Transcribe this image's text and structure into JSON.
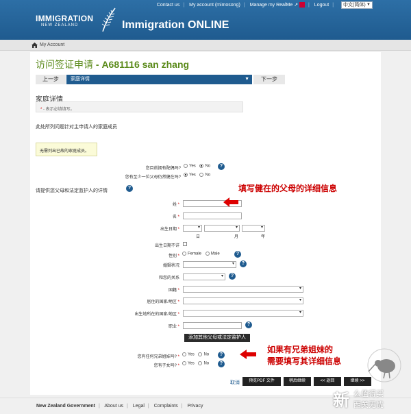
{
  "header": {
    "brand_main": "IMMIGRATION",
    "brand_sub": "NEW ZEALAND",
    "app_title": "Immigration ONLINE",
    "nav": [
      "Contact us",
      "My account (mimosong)",
      "Manage my RealMe",
      "Logout"
    ],
    "language": "中文(简体)"
  },
  "breadcrumb": {
    "label": "My Account"
  },
  "page": {
    "title": "访问签证申请",
    "app_ref": "- A681116 san zhang",
    "prev_label": "上一步",
    "current_step": "家庭详情",
    "next_label": "下一步",
    "section_title": "家庭详情",
    "required_note": "- 表示必填填写。",
    "required_star": "*",
    "intro": "此处所列问题针对主申请人的家庭成员",
    "deceased_note": "无需列出已故的家庭成员。"
  },
  "questions": {
    "partner_q": "您目前拥有配偶吗?",
    "partner_yes": "Yes",
    "partner_no": "No",
    "parent_alive_q": "您有至少一位父母仍然健在吗?",
    "parent_alive_yes": "Yes",
    "parent_alive_no": "No",
    "parent_details_prompt": "请提供您父母和法定监护人的详情"
  },
  "form": {
    "surname": "姓",
    "given_name": "名",
    "dob": "出生日期",
    "day": "日",
    "month": "月",
    "year": "年",
    "dob_unknown": "出生日期不详",
    "gender": "性别",
    "female": "Female",
    "male": "Male",
    "marital": "婚姻状况",
    "relationship": "和您的关系",
    "nationality": "国籍",
    "residence": "居住的国家/地区",
    "birth_country": "出生地所在的国家/地区",
    "occupation": "职业",
    "add_parent": "添加其他父母或法定监护人",
    "siblings_q": "您有任何兄弟姐妹吗?",
    "children_q": "您有子女吗?",
    "yes": "Yes",
    "no": "No"
  },
  "annotations": {
    "first": "填写健在的父母的详细信息",
    "second_line1": "如果有兄弟姐妹的",
    "second_line2": "需要填写其详细信息"
  },
  "actions": {
    "cancel": "取消",
    "preview_pdf": "预览PDF 文件",
    "save_continue": "稍后继续",
    "back": "<< 返回",
    "continue": "继续 >>"
  },
  "footer": {
    "gov": "New Zealand Government",
    "links": [
      "About us",
      "Legal",
      "Complaints",
      "Privacy"
    ]
  },
  "watermark": {
    "glyph": "新",
    "text1": "么值得买",
    "text2": "西关无忧"
  },
  "colors": {
    "header": "#1f5b8f",
    "accent_green": "#5a8a1a",
    "annotation": "#cc0000"
  }
}
